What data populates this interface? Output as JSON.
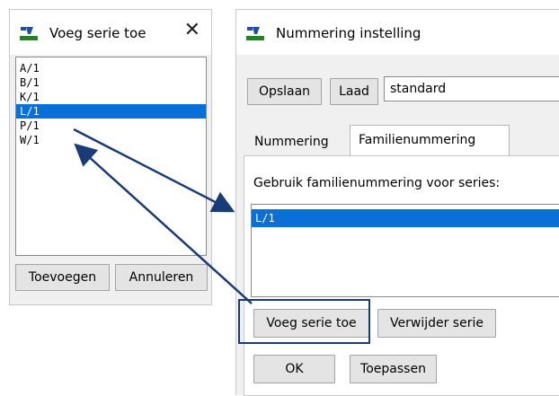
{
  "serie_dialog": {
    "title": "Voeg serie toe",
    "close_icon": "close-icon",
    "items": [
      "A/1",
      "B/1",
      "K/1",
      "L/1",
      "P/1",
      "W/1"
    ],
    "selected_item": "L/1",
    "add_label": "Toevoegen",
    "cancel_label": "Annuleren"
  },
  "main_dialog": {
    "title": "Nummering instelling",
    "save_label": "Opslaan",
    "load_label": "Laad",
    "preset_value": "standard",
    "tabs": [
      {
        "label": "Nummering",
        "active": false
      },
      {
        "label": "Familienummering",
        "active": true
      }
    ],
    "series_label": "Gebruik familienummering voor series:",
    "series_items": [
      "L/1"
    ],
    "add_series_label": "Voeg serie toe",
    "remove_series_label": "Verwijder serie",
    "ok_label": "OK",
    "apply_label": "Toepassen"
  },
  "colors": {
    "selection": "#0a6fd6",
    "arrow": "#1a3b78"
  }
}
